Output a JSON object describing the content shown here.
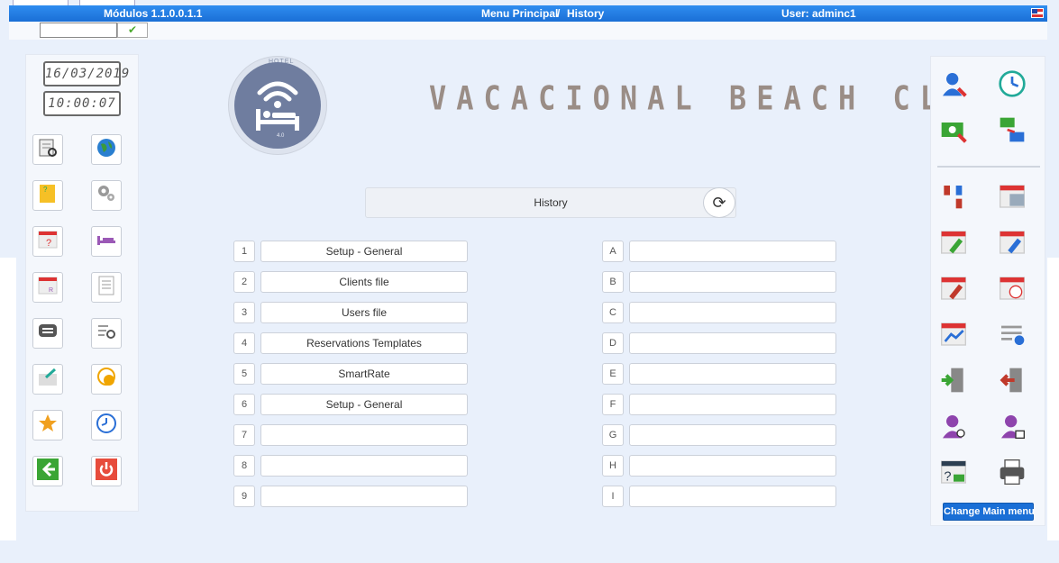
{
  "topbar": {
    "modules": "Módulos 1.1.0.0.1.1",
    "menu": "Menu Principal",
    "separator": "/",
    "section": "History",
    "user": "User: adminc1"
  },
  "left_panel": {
    "date": "16/03/2019",
    "time": "10:00:07",
    "buttons": [
      "book-search-icon",
      "globe-icon",
      "folder-help-icon",
      "gears-icon",
      "calendar-question-icon",
      "bed-icon",
      "calendar-grid-icon",
      "document-list-icon",
      "chat-bubble-icon",
      "list-search-icon",
      "envelope-icon",
      "sms-bubble-icon",
      "star-icon",
      "clock-icon",
      "back-arrow-icon",
      "power-icon"
    ]
  },
  "logo": {
    "top_text": "HOTEL",
    "version": "4.0"
  },
  "brand": "VACACIONAL BEACH CLUB",
  "history_bar": {
    "title": "History"
  },
  "numbered_rows": [
    {
      "key": "1",
      "label": "Setup - General"
    },
    {
      "key": "2",
      "label": "Clients file"
    },
    {
      "key": "3",
      "label": "Users file"
    },
    {
      "key": "4",
      "label": "Reservations Templates"
    },
    {
      "key": "5",
      "label": "SmartRate"
    },
    {
      "key": "6",
      "label": "Setup - General"
    },
    {
      "key": "7",
      "label": ""
    },
    {
      "key": "8",
      "label": ""
    },
    {
      "key": "9",
      "label": ""
    }
  ],
  "lettered_rows": [
    {
      "key": "A",
      "label": ""
    },
    {
      "key": "B",
      "label": ""
    },
    {
      "key": "C",
      "label": ""
    },
    {
      "key": "D",
      "label": ""
    },
    {
      "key": "E",
      "label": ""
    },
    {
      "key": "F",
      "label": ""
    },
    {
      "key": "G",
      "label": ""
    },
    {
      "key": "H",
      "label": ""
    },
    {
      "key": "I",
      "label": ""
    }
  ],
  "right_panel": {
    "change_menu": "Change Main menu"
  },
  "colors": {
    "accent": "#1a6fd6",
    "background": "#e9f0fb"
  }
}
